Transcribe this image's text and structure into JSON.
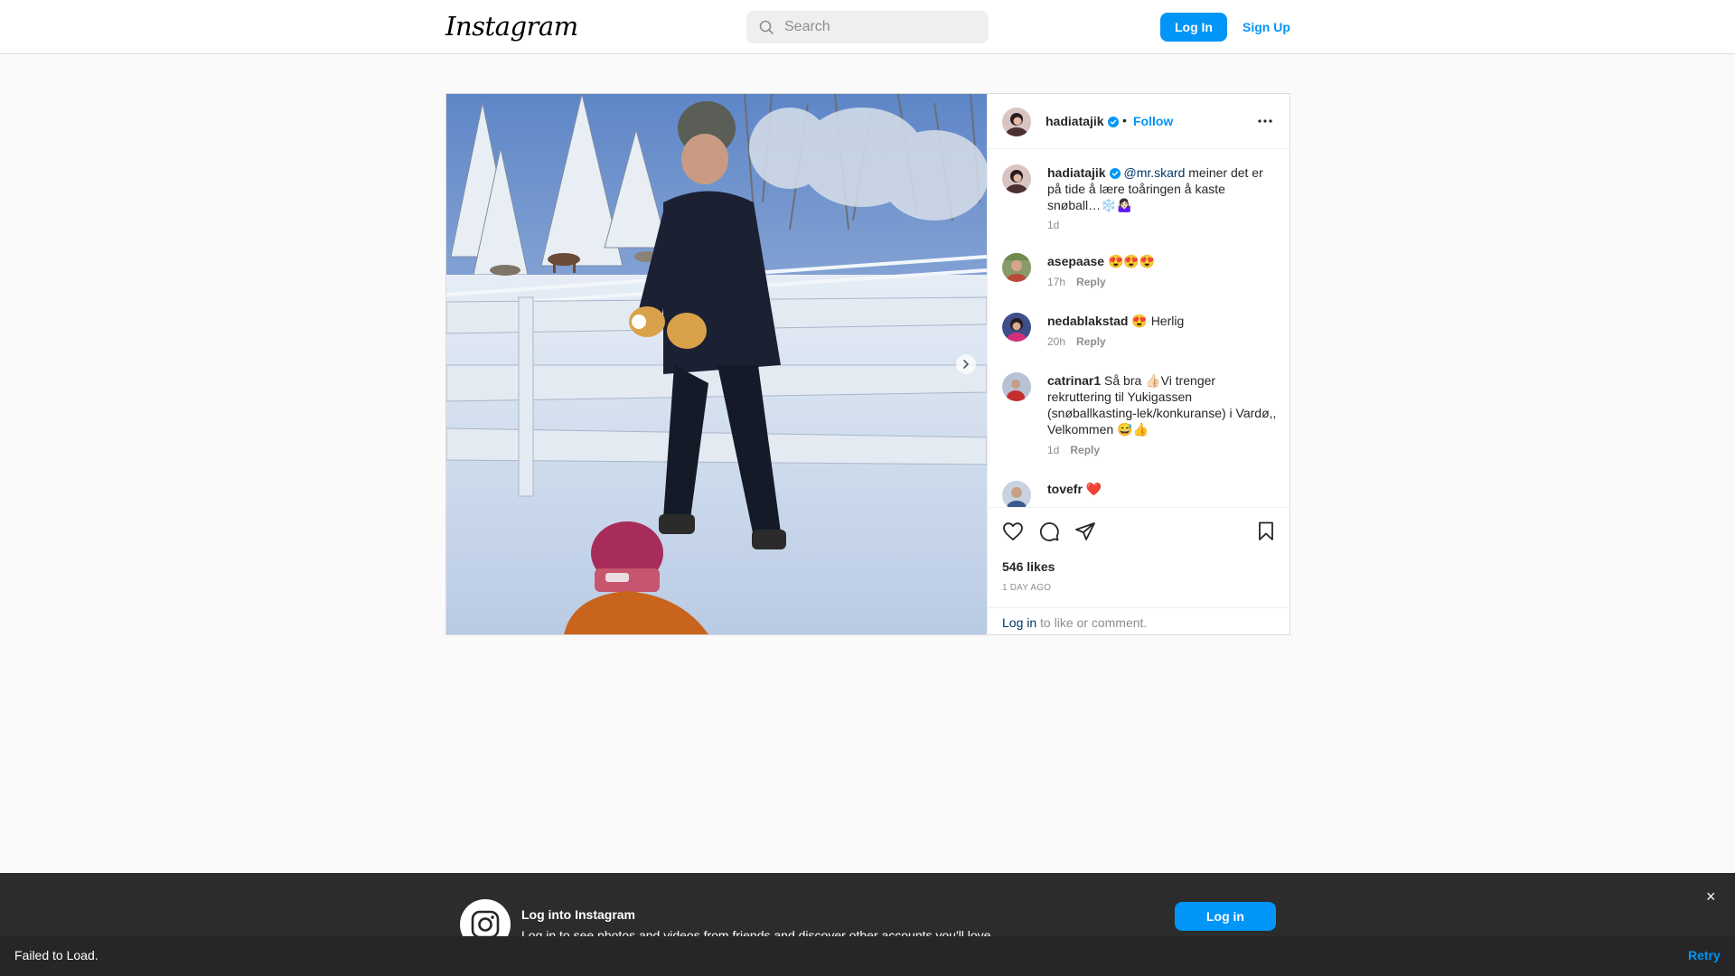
{
  "header": {
    "logo": "Instagram",
    "search_placeholder": "Search",
    "login_label": "Log In",
    "signup_label": "Sign Up"
  },
  "post": {
    "author": "hadiatajik",
    "follow_label": "Follow",
    "dot": "•",
    "caption": {
      "user": "hadiatajik",
      "mention": "@mr.skard",
      "text": " meiner det er på tide å lære toåringen å kaste snøball…❄️🤷🏻‍♀️",
      "time": "1d"
    },
    "comments": [
      {
        "user": "asepaase",
        "text": " 😍😍😍",
        "time": "17h",
        "reply": "Reply"
      },
      {
        "user": "nedablakstad",
        "text": " 😍 Herlig",
        "time": "20h",
        "reply": "Reply"
      },
      {
        "user": "catrinar1",
        "text": " Så bra 👍🏻Vi trenger rekruttering til Yukigassen (snøballkasting-lek/konkuranse) i Vardø,, Velkommen 😅👍",
        "time": "1d",
        "reply": "Reply"
      },
      {
        "user": "tovefr",
        "text": " ❤️",
        "time": "",
        "reply": ""
      }
    ],
    "likes": "546 likes",
    "posted": "1 DAY AGO",
    "login_link": "Log in",
    "login_rest": " to like or comment."
  },
  "banner": {
    "title": "Log into Instagram",
    "subtitle": "Log in to see photos and videos from friends and discover other accounts you'll love.",
    "button": "Log in",
    "close": "×"
  },
  "toast": {
    "message": "Failed to Load.",
    "retry": "Retry"
  },
  "colors": {
    "accent": "#0095f6",
    "link_dark": "#00376b",
    "verified": "#0095f6"
  }
}
